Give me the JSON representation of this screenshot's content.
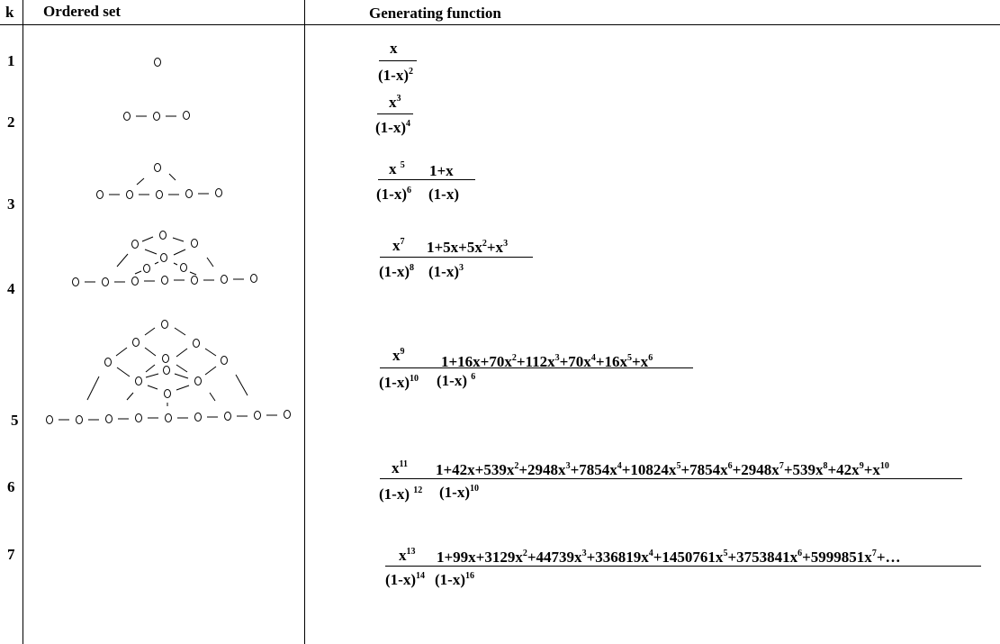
{
  "headers": {
    "k": "k",
    "ordered_set": "Ordered set",
    "gf": "Generating function"
  },
  "rows": [
    {
      "k": "1",
      "num1": "x",
      "den1": "(1-x)",
      "den1_exp": "2"
    },
    {
      "k": "2",
      "num1": "x",
      "num1_exp": "3",
      "den1": "(1-x)",
      "den1_exp": "4"
    },
    {
      "k": "3",
      "num1": "x",
      "num1_exp": "5",
      "den1": "(1-x)",
      "den1_exp": "6",
      "num2": "1+x",
      "den2": "(1-x)"
    },
    {
      "k": "4",
      "num1": "x",
      "num1_exp": "7",
      "den1": "(1-x)",
      "den1_exp": "8",
      "num2_parts": [
        "1+5x+5x",
        "2",
        "+x",
        "3"
      ],
      "den2": "(1-x)",
      "den2_exp": "3"
    },
    {
      "k": "5",
      "num1": "x",
      "num1_exp": "9",
      "den1": "(1-x)",
      "den1_exp": "10",
      "num2_parts": [
        "1+16x+70x",
        "2",
        "+112x",
        "3",
        "+70x",
        "4",
        "+16x",
        "5",
        "+x",
        "6"
      ],
      "den2": "(1-x)",
      "den2_exp": "6"
    },
    {
      "k": "6",
      "num1": "x",
      "num1_exp": "11",
      "den1": "(1-x)",
      "den1_exp": "12",
      "num2_parts": [
        "1+42x+539x",
        "2",
        "+2948x",
        "3",
        "+7854x",
        "4",
        "+10824x",
        "5",
        "+7854x",
        "6",
        "+2948x",
        "7",
        "+539x",
        "8",
        "+42x",
        "9",
        "+x",
        "10"
      ],
      "den2": "(1-x)",
      "den2_exp": "10"
    },
    {
      "k": "7",
      "num1": "x",
      "num1_exp": "13",
      "den1": "(1-x)",
      "den1_exp": "14",
      "num2_parts": [
        "1+99x+3129x",
        "2",
        "+44739x",
        "3",
        "+336819x",
        "4",
        "+1450761x",
        "5",
        "+3753841x",
        "6",
        "+5999851x",
        "7",
        "+…"
      ],
      "den2": "(1-x)",
      "den2_exp": "16"
    }
  ]
}
